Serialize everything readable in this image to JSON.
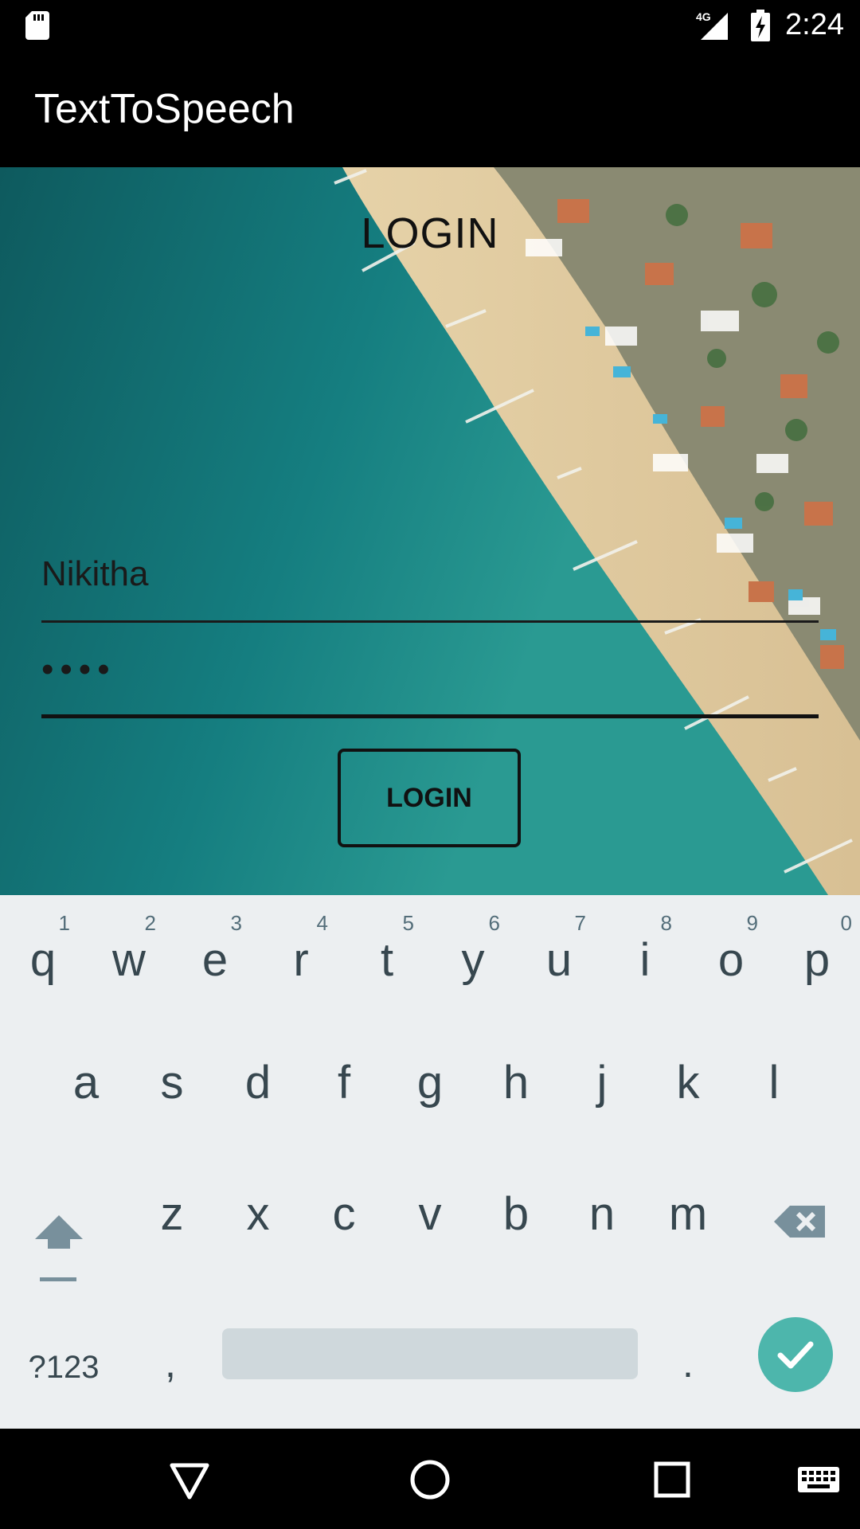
{
  "status_bar": {
    "time": "2:24",
    "network_label": "4G",
    "icons": [
      "sd-card-icon",
      "signal-4g-icon",
      "battery-charging-icon"
    ]
  },
  "app_bar": {
    "title": "TextToSpeech"
  },
  "login_form": {
    "heading": "LOGIN",
    "username_value": "Nikitha",
    "password_value": "••••",
    "button_label": "LOGIN"
  },
  "keyboard": {
    "row1": [
      {
        "key": "q",
        "hint": "1"
      },
      {
        "key": "w",
        "hint": "2"
      },
      {
        "key": "e",
        "hint": "3"
      },
      {
        "key": "r",
        "hint": "4"
      },
      {
        "key": "t",
        "hint": "5"
      },
      {
        "key": "y",
        "hint": "6"
      },
      {
        "key": "u",
        "hint": "7"
      },
      {
        "key": "i",
        "hint": "8"
      },
      {
        "key": "o",
        "hint": "9"
      },
      {
        "key": "p",
        "hint": "0"
      }
    ],
    "row2": [
      "a",
      "s",
      "d",
      "f",
      "g",
      "h",
      "j",
      "k",
      "l"
    ],
    "row3": [
      "z",
      "x",
      "c",
      "v",
      "b",
      "n",
      "m"
    ],
    "symbols_label": "?123",
    "comma_label": ",",
    "period_label": ".",
    "icons": [
      "shift-icon",
      "backspace-icon",
      "checkmark-icon"
    ]
  },
  "nav_bar": {
    "icons": [
      "back-icon",
      "home-icon",
      "recents-icon",
      "keyboard-icon"
    ]
  },
  "colors": {
    "keyboard_bg": "#eceff1",
    "enter_key": "#4db6ac",
    "key_text": "#37474f"
  }
}
